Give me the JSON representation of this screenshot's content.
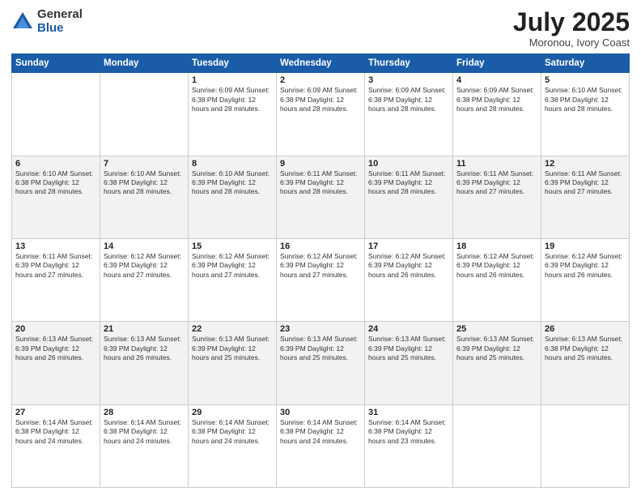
{
  "logo": {
    "general": "General",
    "blue": "Blue"
  },
  "title": "July 2025",
  "location": "Moronou, Ivory Coast",
  "days_of_week": [
    "Sunday",
    "Monday",
    "Tuesday",
    "Wednesday",
    "Thursday",
    "Friday",
    "Saturday"
  ],
  "weeks": [
    [
      {
        "day": "",
        "info": ""
      },
      {
        "day": "",
        "info": ""
      },
      {
        "day": "1",
        "info": "Sunrise: 6:09 AM\nSunset: 6:38 PM\nDaylight: 12 hours and 28 minutes."
      },
      {
        "day": "2",
        "info": "Sunrise: 6:09 AM\nSunset: 6:38 PM\nDaylight: 12 hours and 28 minutes."
      },
      {
        "day": "3",
        "info": "Sunrise: 6:09 AM\nSunset: 6:38 PM\nDaylight: 12 hours and 28 minutes."
      },
      {
        "day": "4",
        "info": "Sunrise: 6:09 AM\nSunset: 6:38 PM\nDaylight: 12 hours and 28 minutes."
      },
      {
        "day": "5",
        "info": "Sunrise: 6:10 AM\nSunset: 6:38 PM\nDaylight: 12 hours and 28 minutes."
      }
    ],
    [
      {
        "day": "6",
        "info": "Sunrise: 6:10 AM\nSunset: 6:38 PM\nDaylight: 12 hours and 28 minutes."
      },
      {
        "day": "7",
        "info": "Sunrise: 6:10 AM\nSunset: 6:38 PM\nDaylight: 12 hours and 28 minutes."
      },
      {
        "day": "8",
        "info": "Sunrise: 6:10 AM\nSunset: 6:39 PM\nDaylight: 12 hours and 28 minutes."
      },
      {
        "day": "9",
        "info": "Sunrise: 6:11 AM\nSunset: 6:39 PM\nDaylight: 12 hours and 28 minutes."
      },
      {
        "day": "10",
        "info": "Sunrise: 6:11 AM\nSunset: 6:39 PM\nDaylight: 12 hours and 28 minutes."
      },
      {
        "day": "11",
        "info": "Sunrise: 6:11 AM\nSunset: 6:39 PM\nDaylight: 12 hours and 27 minutes."
      },
      {
        "day": "12",
        "info": "Sunrise: 6:11 AM\nSunset: 6:39 PM\nDaylight: 12 hours and 27 minutes."
      }
    ],
    [
      {
        "day": "13",
        "info": "Sunrise: 6:11 AM\nSunset: 6:39 PM\nDaylight: 12 hours and 27 minutes."
      },
      {
        "day": "14",
        "info": "Sunrise: 6:12 AM\nSunset: 6:39 PM\nDaylight: 12 hours and 27 minutes."
      },
      {
        "day": "15",
        "info": "Sunrise: 6:12 AM\nSunset: 6:39 PM\nDaylight: 12 hours and 27 minutes."
      },
      {
        "day": "16",
        "info": "Sunrise: 6:12 AM\nSunset: 6:39 PM\nDaylight: 12 hours and 27 minutes."
      },
      {
        "day": "17",
        "info": "Sunrise: 6:12 AM\nSunset: 6:39 PM\nDaylight: 12 hours and 26 minutes."
      },
      {
        "day": "18",
        "info": "Sunrise: 6:12 AM\nSunset: 6:39 PM\nDaylight: 12 hours and 26 minutes."
      },
      {
        "day": "19",
        "info": "Sunrise: 6:12 AM\nSunset: 6:39 PM\nDaylight: 12 hours and 26 minutes."
      }
    ],
    [
      {
        "day": "20",
        "info": "Sunrise: 6:13 AM\nSunset: 6:39 PM\nDaylight: 12 hours and 26 minutes."
      },
      {
        "day": "21",
        "info": "Sunrise: 6:13 AM\nSunset: 6:39 PM\nDaylight: 12 hours and 26 minutes."
      },
      {
        "day": "22",
        "info": "Sunrise: 6:13 AM\nSunset: 6:39 PM\nDaylight: 12 hours and 25 minutes."
      },
      {
        "day": "23",
        "info": "Sunrise: 6:13 AM\nSunset: 6:39 PM\nDaylight: 12 hours and 25 minutes."
      },
      {
        "day": "24",
        "info": "Sunrise: 6:13 AM\nSunset: 6:39 PM\nDaylight: 12 hours and 25 minutes."
      },
      {
        "day": "25",
        "info": "Sunrise: 6:13 AM\nSunset: 6:39 PM\nDaylight: 12 hours and 25 minutes."
      },
      {
        "day": "26",
        "info": "Sunrise: 6:13 AM\nSunset: 6:38 PM\nDaylight: 12 hours and 25 minutes."
      }
    ],
    [
      {
        "day": "27",
        "info": "Sunrise: 6:14 AM\nSunset: 6:38 PM\nDaylight: 12 hours and 24 minutes."
      },
      {
        "day": "28",
        "info": "Sunrise: 6:14 AM\nSunset: 6:38 PM\nDaylight: 12 hours and 24 minutes."
      },
      {
        "day": "29",
        "info": "Sunrise: 6:14 AM\nSunset: 6:38 PM\nDaylight: 12 hours and 24 minutes."
      },
      {
        "day": "30",
        "info": "Sunrise: 6:14 AM\nSunset: 6:38 PM\nDaylight: 12 hours and 24 minutes."
      },
      {
        "day": "31",
        "info": "Sunrise: 6:14 AM\nSunset: 6:38 PM\nDaylight: 12 hours and 23 minutes."
      },
      {
        "day": "",
        "info": ""
      },
      {
        "day": "",
        "info": ""
      }
    ]
  ]
}
